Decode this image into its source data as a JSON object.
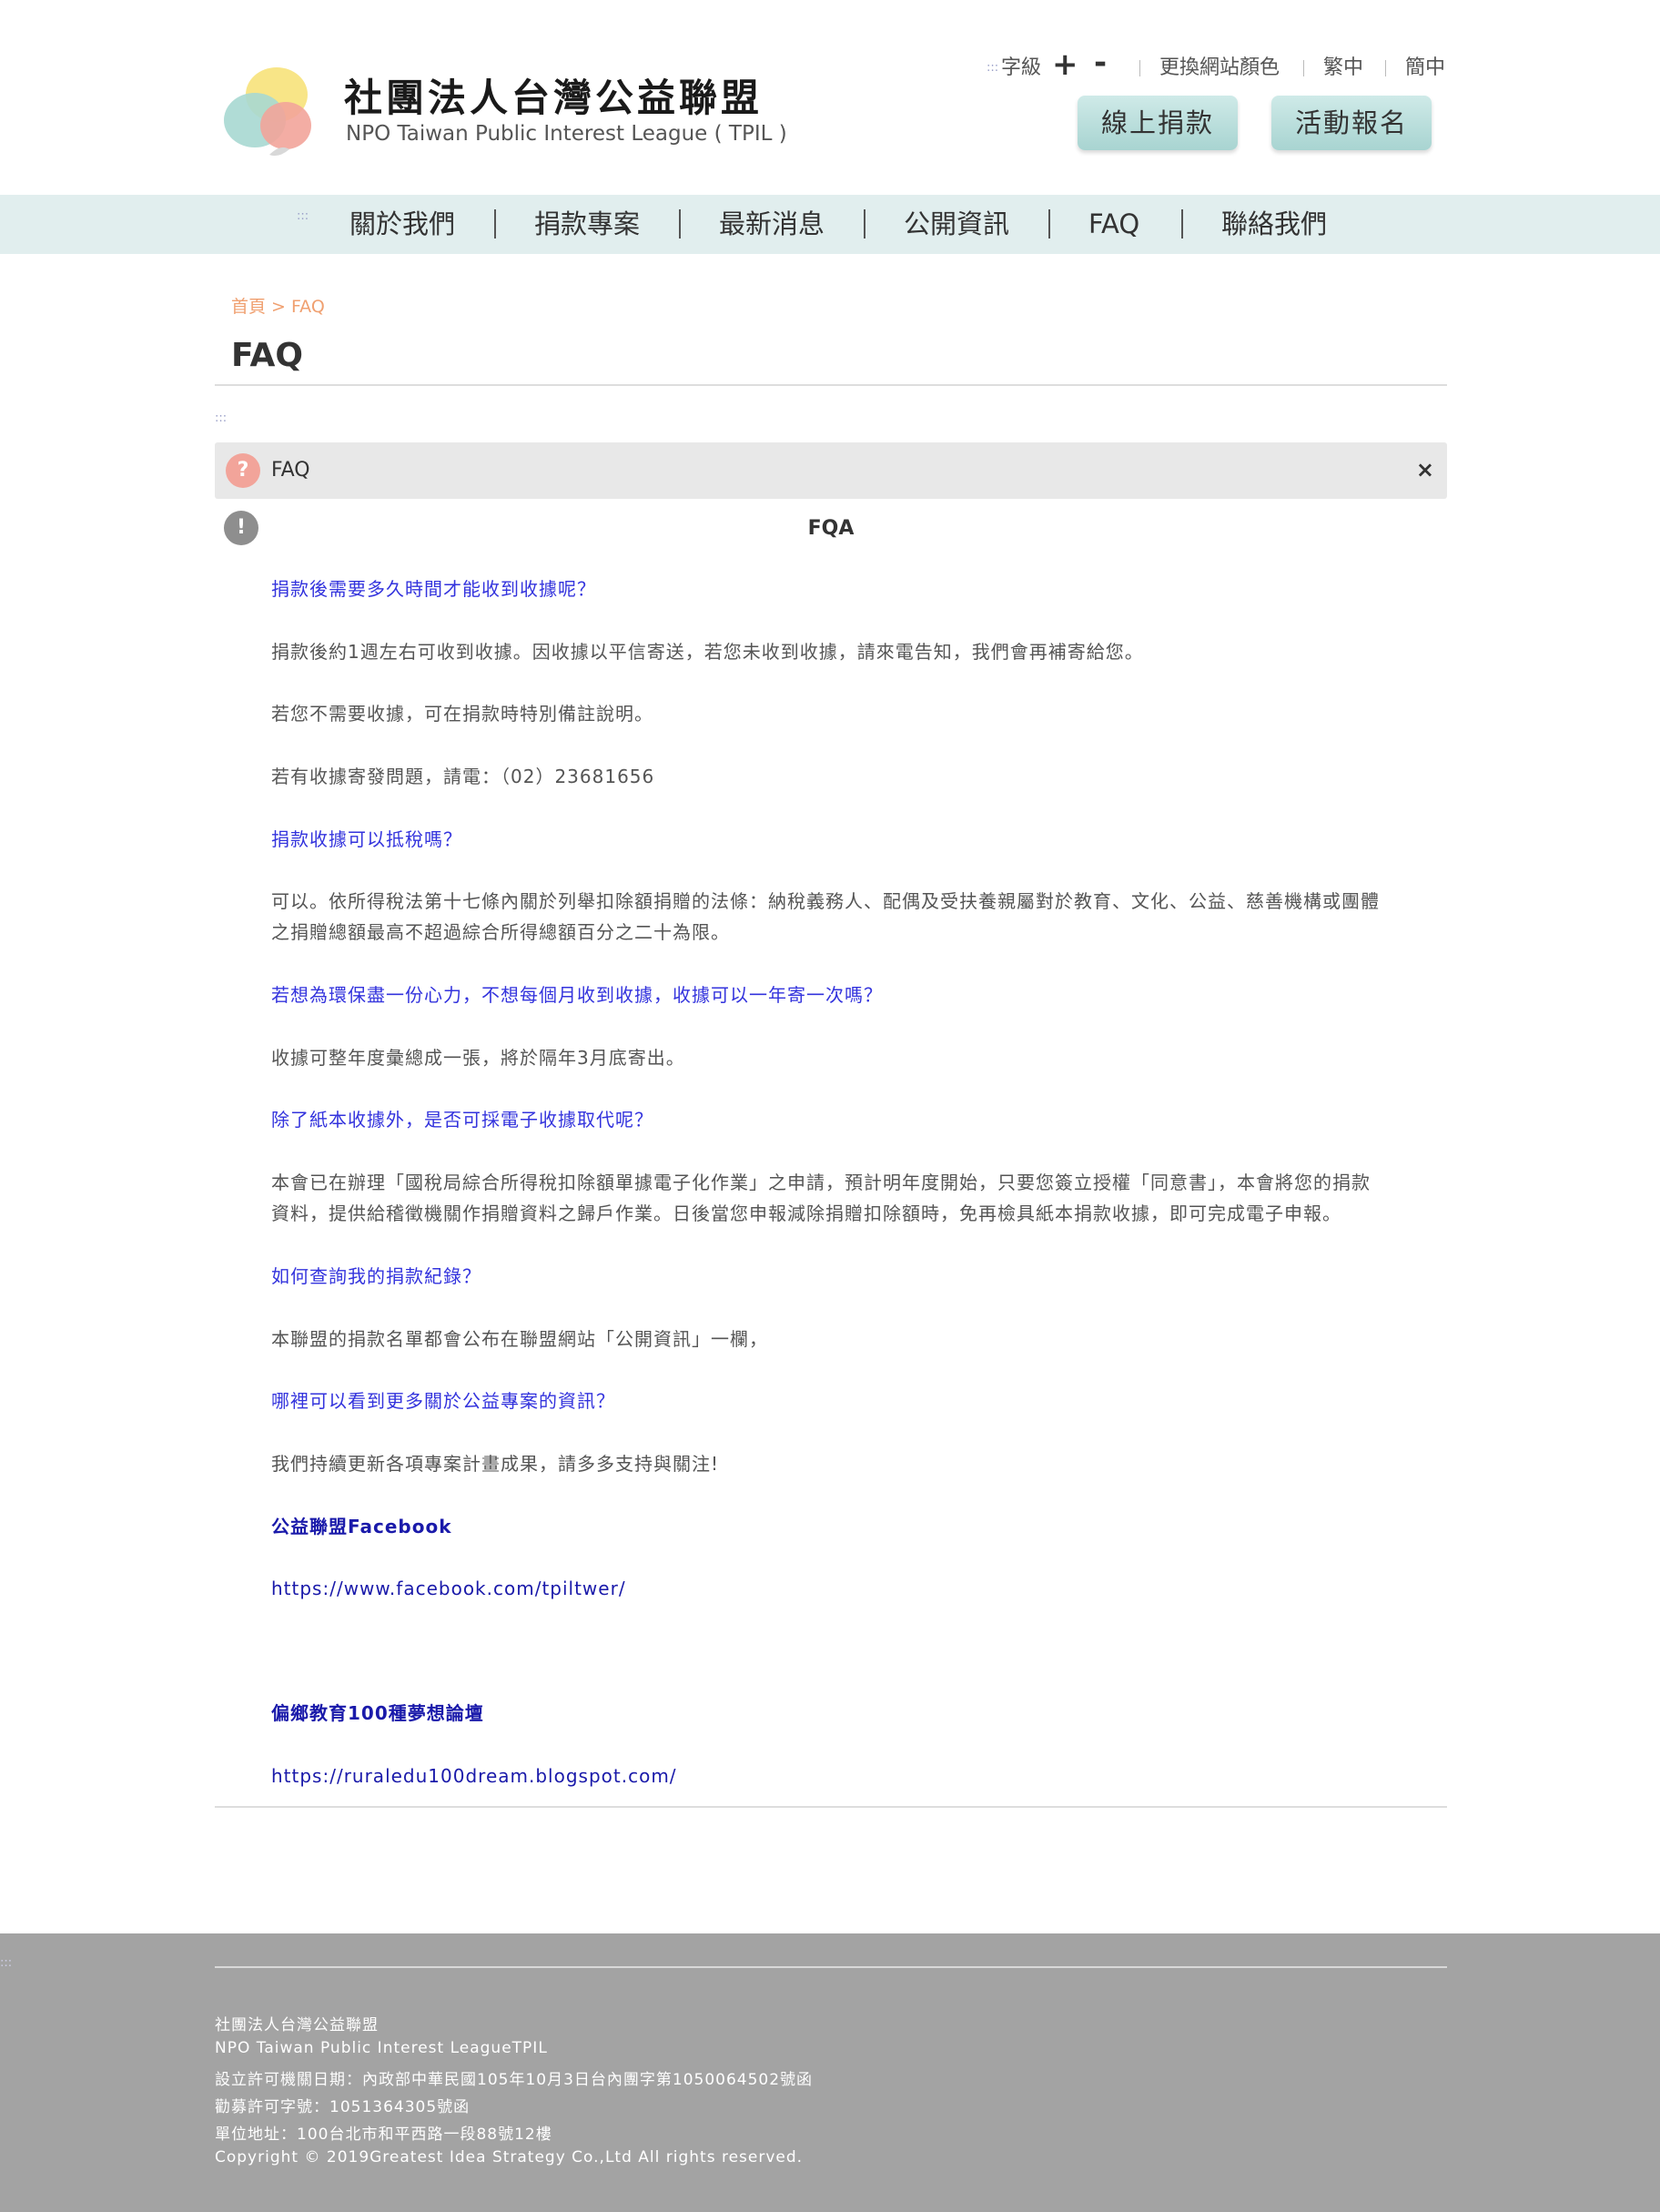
{
  "header": {
    "brand_name": "社團法人台灣公益聯盟",
    "brand_sub": "NPO Taiwan Public Interest League ( TPIL )",
    "access_key": ":::",
    "font_size_label": "字級",
    "font_plus": "+",
    "font_minus": "-",
    "change_color": "更換網站顏色",
    "traditional": "繁中",
    "simplified": "簡中",
    "donate_button": "線上捐款",
    "event_button": "活動報名",
    "colors": {
      "accent_teal": "#a8d4d1",
      "nav_bg": "#e1eeee"
    }
  },
  "nav": {
    "access_key": ":::",
    "items": [
      {
        "label": "關於我們"
      },
      {
        "label": "捐款專案"
      },
      {
        "label": "最新消息"
      },
      {
        "label": "公開資訊"
      },
      {
        "label": "FAQ"
      },
      {
        "label": "聯絡我們"
      }
    ]
  },
  "breadcrumb": "首頁 > FAQ",
  "page_title": "FAQ",
  "content_access_key": ":::",
  "faq_panel": {
    "question_icon": "?",
    "title": "FAQ",
    "close_icon": "×",
    "answer_icon": "!",
    "answer_heading": "FQA"
  },
  "faq_lines": [
    {
      "kind": "q",
      "text": "捐款後需要多久時間才能收到收據呢？"
    },
    {
      "kind": "a",
      "text": "捐款後約1週左右可收到收據。因收據以平信寄送，若您未收到收據，請來電告知，我們會再補寄給您。"
    },
    {
      "kind": "a",
      "text": "若您不需要收據，可在捐款時特別備註說明。"
    },
    {
      "kind": "a",
      "text": "若有收據寄發問題，請電：（02）23681656"
    },
    {
      "kind": "q",
      "text": "捐款收據可以抵稅嗎？"
    },
    {
      "kind": "a",
      "text": "可以。依所得稅法第十七條內關於列舉扣除額捐贈的法條：納稅義務人、配偶及受扶養親屬對於教育、文化、公益、慈善機構或團體"
    },
    {
      "kind": "a",
      "text": "之捐贈總額最高不超過綜合所得總額百分之二十為限。"
    },
    {
      "kind": "q",
      "text": "若想為環保盡一份心力，不想每個月收到收據，收據可以一年寄一次嗎？"
    },
    {
      "kind": "a",
      "text": "收據可整年度彙總成一張，將於隔年3月底寄出。"
    },
    {
      "kind": "q",
      "text": "除了紙本收據外，是否可採電子收據取代呢？"
    },
    {
      "kind": "a",
      "text": "本會已在辦理「國稅局綜合所得稅扣除額單據電子化作業」之申請，預計明年度開始，只要您簽立授權「同意書」，本會將您的捐款"
    },
    {
      "kind": "a",
      "text": "資料，提供給稽徵機關作捐贈資料之歸戶作業。日後當您申報減除捐贈扣除額時，免再檢具紙本捐款收據，即可完成電子申報。"
    },
    {
      "kind": "q",
      "text": "如何查詢我的捐款紀錄？"
    },
    {
      "kind": "a",
      "text": "本聯盟的捐款名單都會公布在聯盟網站「公開資訊」一欄，"
    },
    {
      "kind": "q",
      "text": "哪裡可以看到更多關於公益專案的資訊？"
    },
    {
      "kind": "a",
      "text": "我們持續更新各項專案計畫成果，請多多支持與關注!"
    },
    {
      "kind": "strong-link",
      "text": "公益聯盟Facebook"
    },
    {
      "kind": "url",
      "text": "https://www.facebook.com/tpiltwer/"
    },
    {
      "kind": "strong-link",
      "text": "偏鄉教育100種夢想論壇"
    },
    {
      "kind": "url",
      "text": "https://ruraledu100dream.blogspot.com/"
    }
  ],
  "footer": {
    "access_key": ":::",
    "lines": [
      "社團法人台灣公益聯盟",
      "NPO Taiwan Public Interest LeagueTPIL",
      "設立許可機關日期：內政部中華民國105年10月3日台內團字第1050064502號函",
      "勸募許可字號：1051364305號函",
      "單位地址：100台北市和平西路一段88號12樓",
      "Copyright © 2019Greatest Idea Strategy Co.,Ltd All rights reserved."
    ]
  }
}
